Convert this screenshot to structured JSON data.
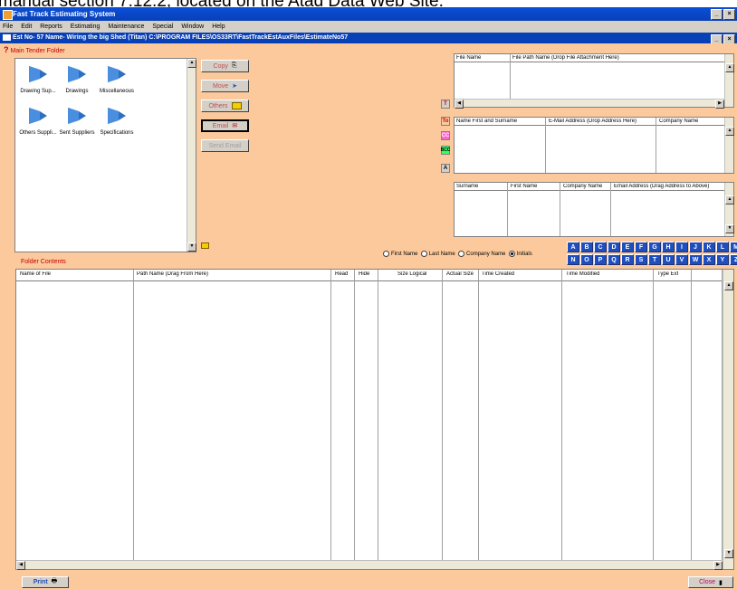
{
  "caption": "manual section 7.12.2, located on the Atad Data Web Site.",
  "app": {
    "title": "Fast Track Estimating System",
    "window_buttons": [
      "_",
      "×"
    ]
  },
  "menu": [
    "File",
    "Edit",
    "Reports",
    "Estimating",
    "Maintenance",
    "Special",
    "Window",
    "Help"
  ],
  "child_window": {
    "title": "Est No- 57  Name- Wiring the big Shed (Titan)  C:\\PROGRAM FILES\\OS33RT\\FastTrackEstAuxFiles\\EstimateNo57",
    "window_buttons": [
      "_",
      "×"
    ]
  },
  "main_tender": {
    "label": "Main Tender Folder",
    "folders": [
      {
        "name": "Drawing Sup..."
      },
      {
        "name": "Drawings"
      },
      {
        "name": "Miscellaneous"
      },
      {
        "name": "Others Suppli..."
      },
      {
        "name": "Sent Suppliers"
      },
      {
        "name": "Specifications"
      }
    ]
  },
  "actions": {
    "copy": "Copy",
    "move": "Move",
    "others": "Others",
    "email": "Email",
    "send_email": "Send Email"
  },
  "files_table": {
    "columns": [
      "File Name",
      "File Path Name (Drop File Attachment Here)"
    ]
  },
  "side_buttons": [
    "T",
    "To",
    "CC",
    "BCC",
    "A"
  ],
  "recipients_table": {
    "columns": [
      "Name First and Surname",
      "E-Mail Address (Drop Address Here)",
      "Company Name"
    ]
  },
  "contacts_table": {
    "columns": [
      "Surname",
      "First Name",
      "Company Name",
      "Email Address (Drag Address to Above)"
    ]
  },
  "sort_options": {
    "items": [
      "First Name",
      "Last Name",
      "Company Name",
      "Initials"
    ],
    "selected": "Initials"
  },
  "letters_row1": [
    "A",
    "B",
    "C",
    "D",
    "E",
    "F",
    "G",
    "H",
    "I",
    "J",
    "K",
    "L",
    "M"
  ],
  "letters_row2": [
    "N",
    "O",
    "P",
    "Q",
    "R",
    "S",
    "T",
    "U",
    "V",
    "W",
    "X",
    "Y",
    "Z"
  ],
  "folder_contents": {
    "label": "Folder Contents",
    "columns": [
      "Name of File",
      "Path Name (Drag From Here)",
      "Read",
      "Hide",
      "Size Logical",
      "Actual Size",
      "Time Created",
      "Time Modified",
      "Type Ext"
    ]
  },
  "footer": {
    "print": "Print",
    "close": "Close"
  },
  "colors": {
    "background": "#fcc99c",
    "title_blue": "#0840b8",
    "letter_blue": "#1f4fbf",
    "cc_pink": "#ff66cc",
    "bcc_green": "#33ff66"
  }
}
